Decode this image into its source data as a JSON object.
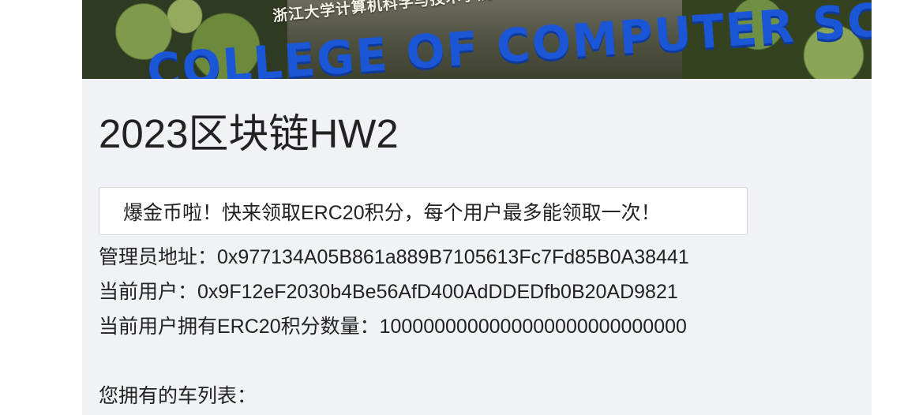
{
  "banner": {
    "school_name": "浙江大学计算机科学与技术学院",
    "sign_text": "COLLEGE OF COMPUTER SCIENCE"
  },
  "page_title": "2023区块链HW2",
  "claim_button_label": "爆金币啦！快来领取ERC20积分，每个用户最多能领取一次！",
  "admin": {
    "label": "管理员地址：",
    "address": "0x977134A05B861a889B7105613Fc7Fd85B0A38441"
  },
  "user": {
    "label": "当前用户：",
    "address": "0x9F12eF2030b4Be56AfD400AdDDEDfb0B20AD9821"
  },
  "balance": {
    "label": "当前用户拥有ERC20积分数量：",
    "value": "1000000000000000000000000000"
  },
  "car_list": {
    "label": "您拥有的车列表："
  }
}
